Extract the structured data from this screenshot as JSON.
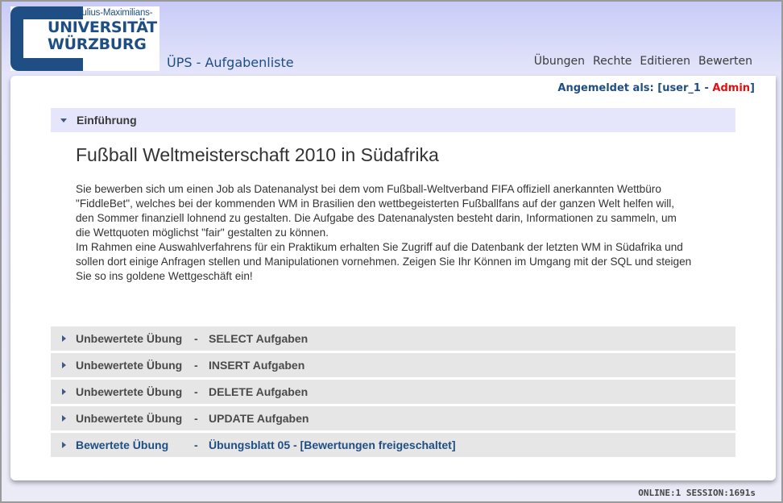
{
  "logo": {
    "small": "Julius-Maximilians-",
    "line1": "UNIVERSITÄT",
    "line2": "WÜRZBURG"
  },
  "app_title": "ÜPS - Aufgabenliste",
  "nav": [
    "Übungen",
    "Rechte",
    "Editieren",
    "Bewerten"
  ],
  "login": {
    "label": "Angemeldet als: [",
    "user": "user_1",
    "dash": " - ",
    "role": "Admin",
    "close": "]"
  },
  "intro": {
    "header": "Einführung",
    "title": "Fußball Weltmeisterschaft 2010 in Südafrika",
    "lines": [
      "Sie bewerben sich um einen Job als Datenanalyst bei dem vom Fußball-Weltverband FIFA offiziell anerkannten Wettbüro",
      "\"FiddleBet\", welches bei der kommenden WM in Brasilien den wettbegeisterten Fußballfans auf der ganzen Welt helfen will,",
      "den Sommer finanziell lohnend zu gestalten. Die Aufgabe des Datenanalysten besteht darin, Informationen zu sammeln, um",
      "die Wettquoten möglichst \"fair\" gestalten zu können.",
      "Im Rahmen eine Auswahlverfahrens für ein Praktikum erhalten Sie Zugriff auf die Datenbank der letzten WM in Südafrika und",
      "sollen dort einige Anfragen stellen und Manipulationen vornehmen. Zeigen Sie Ihr Können im Umgang mit der SQL und steigen",
      "Sie so ins goldene Wettgeschäft ein!"
    ]
  },
  "exercises": [
    {
      "type": "Unbewertete Übung",
      "sep": "-",
      "name": "SELECT Aufgaben"
    },
    {
      "type": "Unbewertete Übung",
      "sep": "-",
      "name": "INSERT Aufgaben"
    },
    {
      "type": "Unbewertete Übung",
      "sep": "-",
      "name": "DELETE Aufgaben"
    },
    {
      "type": "Unbewertete Übung",
      "sep": "-",
      "name": "UPDATE Aufgaben"
    },
    {
      "type": "Bewertete Übung",
      "sep": "-",
      "name": "Übungsblatt 05 - [Bewertungen freigeschaltet]"
    }
  ],
  "status": "ONLINE:1 SESSION:1691s",
  "colors": {
    "brand": "#1f4e85",
    "admin": "#e01010",
    "header_bg": "#e5e6fb",
    "row_bg": "#e6e6e6"
  }
}
